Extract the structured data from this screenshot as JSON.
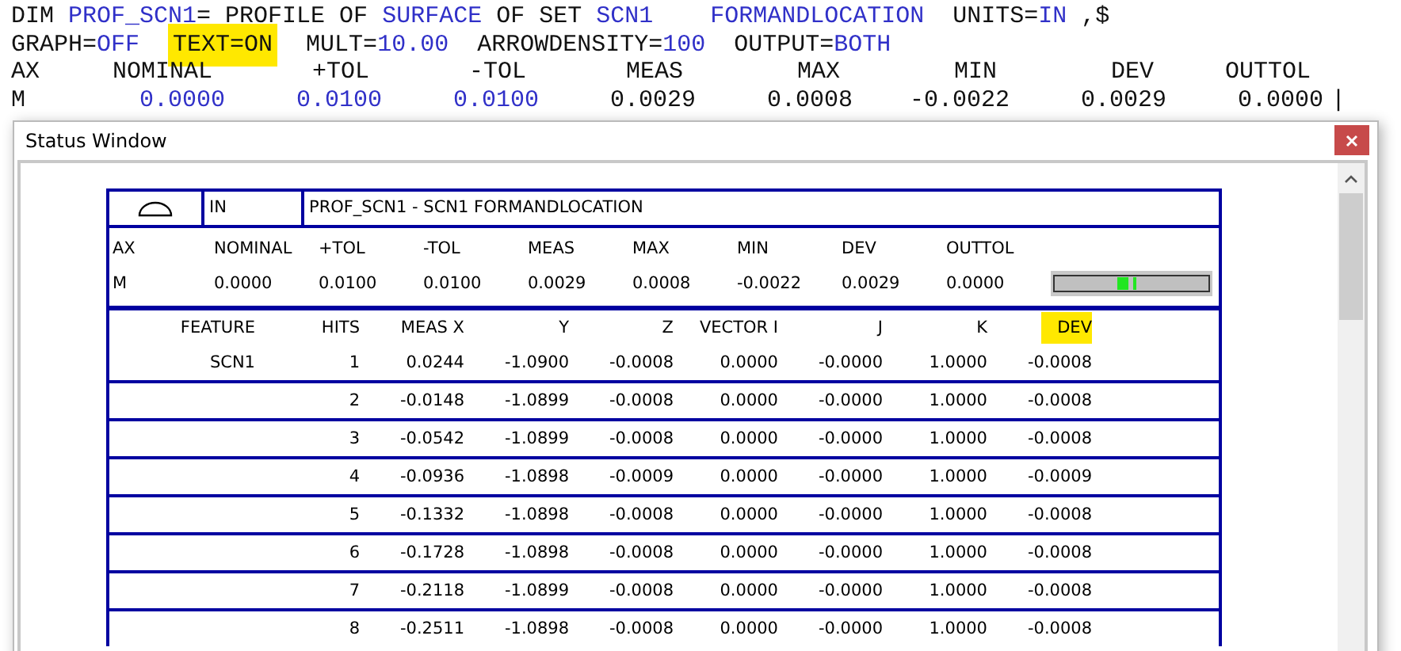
{
  "editor": {
    "lines": [
      {
        "segments": [
          {
            "text": "DIM ",
            "kind": "plain",
            "highlighted": false
          },
          {
            "text": "PROF_SCN1",
            "kind": "value",
            "highlighted": false
          },
          {
            "text": "= PROFILE OF ",
            "kind": "plain",
            "highlighted": false
          },
          {
            "text": "SURFACE",
            "kind": "value",
            "highlighted": false
          },
          {
            "text": " OF SET ",
            "kind": "plain",
            "highlighted": false
          },
          {
            "text": "SCN1",
            "kind": "value",
            "highlighted": false
          },
          {
            "text": "    FORMANDLOCATION",
            "kind": "value",
            "highlighted": false
          },
          {
            "text": "  UNITS=",
            "kind": "plain",
            "highlighted": false
          },
          {
            "text": "IN",
            "kind": "value",
            "highlighted": false
          },
          {
            "text": " ,$",
            "kind": "plain",
            "highlighted": false
          }
        ]
      },
      {
        "segments": [
          {
            "text": "GRAPH=",
            "kind": "plain",
            "highlighted": false
          },
          {
            "text": "OFF  ",
            "kind": "value",
            "highlighted": false
          },
          {
            "text": "TEXT=ON",
            "kind": "plain",
            "highlighted": true
          },
          {
            "text": "  MULT=",
            "kind": "plain",
            "highlighted": false
          },
          {
            "text": "10.00",
            "kind": "value",
            "highlighted": false
          },
          {
            "text": "  ARROWDENSITY=",
            "kind": "plain",
            "highlighted": false
          },
          {
            "text": "100",
            "kind": "value",
            "highlighted": false
          },
          {
            "text": "  OUTPUT=",
            "kind": "plain",
            "highlighted": false
          },
          {
            "text": "BOTH",
            "kind": "value",
            "highlighted": false
          }
        ]
      }
    ],
    "result": {
      "columns": [
        "AX",
        "NOMINAL",
        "+TOL",
        "-TOL",
        "MEAS",
        "MAX",
        "MIN",
        "DEV",
        "OUTTOL"
      ],
      "values": [
        {
          "text": "M",
          "kind": "plain"
        },
        {
          "text": "0.0000",
          "kind": "value"
        },
        {
          "text": "0.0100",
          "kind": "value"
        },
        {
          "text": "0.0100",
          "kind": "value"
        },
        {
          "text": "0.0029",
          "kind": "plain"
        },
        {
          "text": "0.0008",
          "kind": "plain"
        },
        {
          "text": "-0.0022",
          "kind": "plain"
        },
        {
          "text": "0.0029",
          "kind": "plain"
        },
        {
          "text": "0.0000",
          "kind": "plain"
        }
      ],
      "cursor": "|"
    }
  },
  "status_window": {
    "title": "Status Window",
    "report": {
      "units": "IN",
      "title": "PROF_SCN1 - SCN1  FORMANDLOCATION",
      "summary": {
        "columns": [
          "AX",
          "NOMINAL",
          "+TOL",
          "-TOL",
          "MEAS",
          "MAX",
          "MIN",
          "DEV",
          "OUTTOL"
        ],
        "values": [
          "M",
          "0.0000",
          "0.0100",
          "0.0100",
          "0.0029",
          "0.0008",
          "-0.0022",
          "0.0029",
          "0.0000"
        ]
      },
      "points": {
        "columns": [
          {
            "text": "FEATURE",
            "highlighted": false
          },
          {
            "text": "HITS",
            "highlighted": false
          },
          {
            "text": "MEAS X",
            "highlighted": false
          },
          {
            "text": "Y",
            "highlighted": false
          },
          {
            "text": "Z",
            "highlighted": false
          },
          {
            "text": "VECTOR I",
            "highlighted": false
          },
          {
            "text": "J",
            "highlighted": false
          },
          {
            "text": "K",
            "highlighted": false
          },
          {
            "text": "DEV",
            "highlighted": true
          }
        ],
        "rows": [
          {
            "feature": "SCN1",
            "values": [
              "1",
              "0.0244",
              "-1.0900",
              "-0.0008",
              "0.0000",
              "-0.0000",
              "1.0000",
              "-0.0008"
            ]
          },
          {
            "values": [
              "2",
              "-0.0148",
              "-1.0899",
              "-0.0008",
              "0.0000",
              "-0.0000",
              "1.0000",
              "-0.0008"
            ]
          },
          {
            "values": [
              "3",
              "-0.0542",
              "-1.0899",
              "-0.0008",
              "0.0000",
              "-0.0000",
              "1.0000",
              "-0.0008"
            ]
          },
          {
            "values": [
              "4",
              "-0.0936",
              "-1.0898",
              "-0.0009",
              "0.0000",
              "-0.0000",
              "1.0000",
              "-0.0009"
            ]
          },
          {
            "values": [
              "5",
              "-0.1332",
              "-1.0898",
              "-0.0008",
              "0.0000",
              "-0.0000",
              "1.0000",
              "-0.0008"
            ]
          },
          {
            "values": [
              "6",
              "-0.1728",
              "-1.0898",
              "-0.0008",
              "0.0000",
              "-0.0000",
              "1.0000",
              "-0.0008"
            ]
          },
          {
            "values": [
              "7",
              "-0.2118",
              "-1.0899",
              "-0.0008",
              "0.0000",
              "-0.0000",
              "1.0000",
              "-0.0008"
            ]
          },
          {
            "values": [
              "8",
              "-0.2511",
              "-1.0898",
              "-0.0008",
              "0.0000",
              "-0.0000",
              "1.0000",
              "-0.0008"
            ]
          }
        ]
      }
    }
  }
}
